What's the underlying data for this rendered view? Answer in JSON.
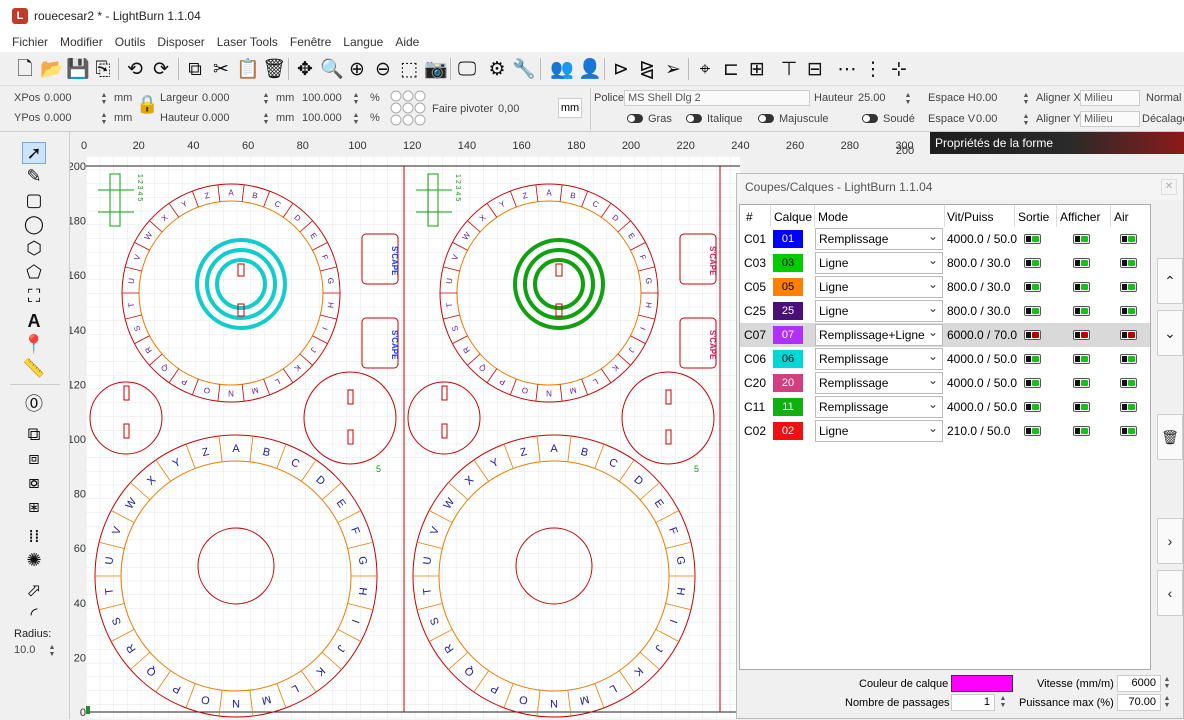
{
  "window": {
    "title": "rouecesar2 * - LightBurn 1.1.04",
    "logo": "lightburn-logo"
  },
  "menu": [
    "Fichier",
    "Modifier",
    "Outils",
    "Disposer",
    "Laser Tools",
    "Fenêtre",
    "Langue",
    "Aide"
  ],
  "numeric": {
    "xpos_label": "XPos",
    "xpos": "0.000",
    "ypos_label": "YPos",
    "ypos": "0.000",
    "unit": "mm",
    "width_label": "Largeur",
    "width": "0.000",
    "height_label": "Hauteur",
    "height": "0.000",
    "scale_w": "100.000",
    "scale_h": "100.000",
    "pct": "%",
    "rotate_label": "Faire pivoter",
    "rotate": "0,00",
    "mm_btn": "mm"
  },
  "text_props": {
    "font_label": "Police",
    "font": "MS Shell Dlg 2",
    "size_label": "Hauteur",
    "size": "25.00",
    "hspace_label": "Espace H",
    "hspace": "0.00",
    "vspace_label": "Espace V",
    "vspace": "0.00",
    "alignx_label": "Aligner X",
    "alignx": "Milieu",
    "aligny_label": "Aligner Y",
    "aligny": "Milieu",
    "style": "Normal",
    "offset": "Décalage",
    "bold": "Gras",
    "italic": "Italique",
    "upper": "Majuscule",
    "welded": "Soudé"
  },
  "rulers": {
    "x": [
      "0",
      "20",
      "40",
      "60",
      "80",
      "100",
      "120",
      "140",
      "160",
      "180",
      "200",
      "220",
      "240",
      "260",
      "280",
      "300"
    ],
    "y": [
      "200",
      "180",
      "160",
      "140",
      "120",
      "100",
      "80",
      "60",
      "40",
      "20",
      "0"
    ],
    "right_200": "200"
  },
  "left_tools": {
    "radius_label": "Radius:",
    "radius": "10.0"
  },
  "shape_props_title": "Propriétés de la forme",
  "cuts": {
    "title": "Coupes/Calques - LightBurn 1.1.04",
    "headers": [
      "#",
      "Calque",
      "Mode",
      "Vit/Puiss",
      "Sortie",
      "Afficher",
      "Air"
    ],
    "rows": [
      {
        "id": "C01",
        "layer": "01",
        "color": "#0000ff",
        "fg": "#fff",
        "mode": "Remplissage",
        "vp": "4000.0 / 50.0",
        "sortie": true,
        "afficher": true,
        "air": true
      },
      {
        "id": "C03",
        "layer": "03",
        "color": "#00cc00",
        "fg": "#000",
        "mode": "Ligne",
        "vp": "800.0 / 30.0",
        "sortie": true,
        "afficher": true,
        "air": true
      },
      {
        "id": "C05",
        "layer": "05",
        "color": "#ff8000",
        "fg": "#000",
        "mode": "Ligne",
        "vp": "800.0 / 30.0",
        "sortie": true,
        "afficher": true,
        "air": true
      },
      {
        "id": "C25",
        "layer": "25",
        "color": "#4b0f7a",
        "fg": "#fff",
        "mode": "Ligne",
        "vp": "800.0 / 30.0",
        "sortie": true,
        "afficher": true,
        "air": true
      },
      {
        "id": "C07",
        "layer": "07",
        "color": "#b030ff",
        "fg": "#fff",
        "mode": "Remplissage+Ligne",
        "vp": "6000.0 / 70.0",
        "sortie": false,
        "afficher": false,
        "air": false
      },
      {
        "id": "C06",
        "layer": "06",
        "color": "#00d8d8",
        "fg": "#000",
        "mode": "Remplissage",
        "vp": "4000.0 / 50.0",
        "sortie": true,
        "afficher": true,
        "air": true
      },
      {
        "id": "C20",
        "layer": "20",
        "color": "#d04080",
        "fg": "#fff",
        "mode": "Remplissage",
        "vp": "4000.0 / 50.0",
        "sortie": true,
        "afficher": true,
        "air": true
      },
      {
        "id": "C11",
        "layer": "11",
        "color": "#10b010",
        "fg": "#fff",
        "mode": "Remplissage",
        "vp": "4000.0 / 50.0",
        "sortie": true,
        "afficher": true,
        "air": true
      },
      {
        "id": "C02",
        "layer": "02",
        "color": "#ee1111",
        "fg": "#fff",
        "mode": "Ligne",
        "vp": "210.0 / 50.0",
        "sortie": true,
        "afficher": true,
        "air": true
      }
    ],
    "layer_color_label": "Couleur de calque",
    "layer_color": "#ff00ff",
    "passes_label": "Nombre de passages",
    "passes": "1",
    "speed_label": "Vitesse (mm/m)",
    "speed": "6000",
    "power_label": "Puissance max (%)",
    "power": "70.00"
  },
  "wheels": {
    "outer_letters": [
      "A",
      "B",
      "C",
      "D",
      "E",
      "F",
      "G",
      "H",
      "I",
      "J",
      "K",
      "L",
      "M",
      "N",
      "O",
      "P",
      "Q",
      "R",
      "S",
      "T",
      "U",
      "V",
      "W",
      "X",
      "Y",
      "Z"
    ],
    "inner_numbers_label": "1 2 3 4 5",
    "tag_text": "S'CAPE",
    "stamp_number": "5"
  }
}
